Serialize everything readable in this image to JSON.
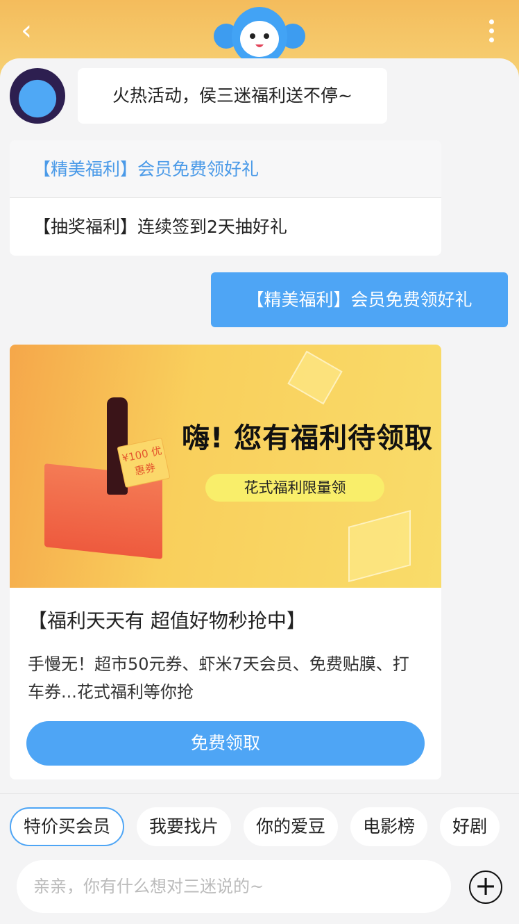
{
  "header": {
    "back_icon": "chevron-left-icon",
    "more_icon": "more-vertical-icon",
    "mascot": "blue-monkey-mascot"
  },
  "chat": {
    "bot_greeting": "火热活动，侯三迷福利送不停~",
    "menu": [
      {
        "label": "【精美福利】会员免费领好礼"
      },
      {
        "label": "【抽奖福利】连续签到2天抽好礼"
      }
    ],
    "user_message": "【精美福利】会员免费领好礼",
    "card": {
      "banner_headline": "嗨! 您有福利待领取",
      "banner_subline": "花式福利限量领",
      "banner_coupon": "¥100 优惠券",
      "title": "【福利天天有 超值好物秒抢中】",
      "description": "手慢无！超市50元券、虾米7天会员、免费贴膜、打车券...花式福利等你抢",
      "button": "免费领取"
    }
  },
  "chips": [
    "特价买会员",
    "我要找片",
    "你的爱豆",
    "电影榜",
    "好剧"
  ],
  "input": {
    "placeholder": "亲亲，你有什么想对三迷说的~",
    "add_icon": "plus-circle-icon"
  },
  "colors": {
    "accent": "#4ea5f5",
    "header": "#f4bc5c"
  }
}
